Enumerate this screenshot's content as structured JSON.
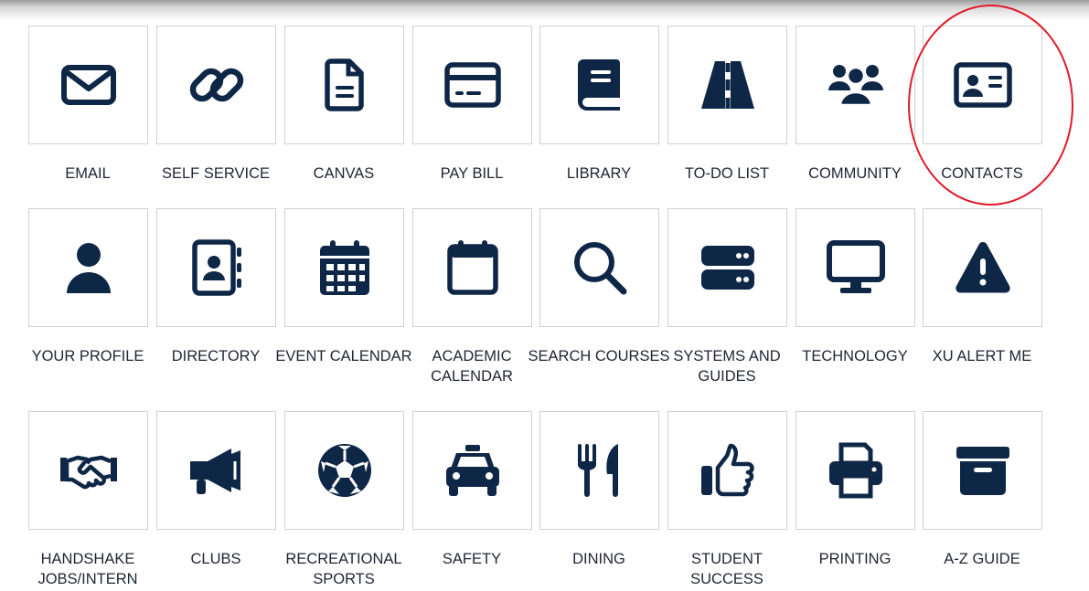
{
  "colors": {
    "icon": "#0f2747",
    "label": "#1e2533",
    "tile_border": "#d0d0d0",
    "annotation": "#e0192a"
  },
  "tiles": [
    {
      "label": "EMAIL",
      "icon": "envelope-icon"
    },
    {
      "label": "SELF SERVICE",
      "icon": "link-icon"
    },
    {
      "label": "CANVAS",
      "icon": "document-icon"
    },
    {
      "label": "PAY BILL",
      "icon": "credit-card-icon"
    },
    {
      "label": "LIBRARY",
      "icon": "book-icon"
    },
    {
      "label": "TO-DO LIST",
      "icon": "road-icon"
    },
    {
      "label": "COMMUNITY",
      "icon": "users-icon"
    },
    {
      "label": "CONTACTS",
      "icon": "id-card-icon"
    },
    {
      "label": "YOUR PROFILE",
      "icon": "user-icon"
    },
    {
      "label": "DIRECTORY",
      "icon": "address-book-icon"
    },
    {
      "label": "EVENT CALENDAR",
      "icon": "calendar-days-icon"
    },
    {
      "label": "ACADEMIC CALENDAR",
      "icon": "calendar-icon"
    },
    {
      "label": "SEARCH COURSES",
      "icon": "search-icon"
    },
    {
      "label": "SYSTEMS AND GUIDES",
      "icon": "server-icon"
    },
    {
      "label": "TECHNOLOGY",
      "icon": "desktop-icon"
    },
    {
      "label": "XU ALERT ME",
      "icon": "warning-icon"
    },
    {
      "label": "HANDSHAKE JOBS/INTERN",
      "icon": "handshake-icon"
    },
    {
      "label": "CLUBS",
      "icon": "bullhorn-icon"
    },
    {
      "label": "RECREATIONAL SPORTS",
      "icon": "soccer-ball-icon"
    },
    {
      "label": "SAFETY",
      "icon": "taxi-icon"
    },
    {
      "label": "DINING",
      "icon": "utensils-icon"
    },
    {
      "label": "STUDENT SUCCESS",
      "icon": "thumbs-up-icon"
    },
    {
      "label": "PRINTING",
      "icon": "printer-icon"
    },
    {
      "label": "A-Z GUIDE",
      "icon": "archive-box-icon"
    }
  ],
  "highlighted_tile": "CONTACTS"
}
